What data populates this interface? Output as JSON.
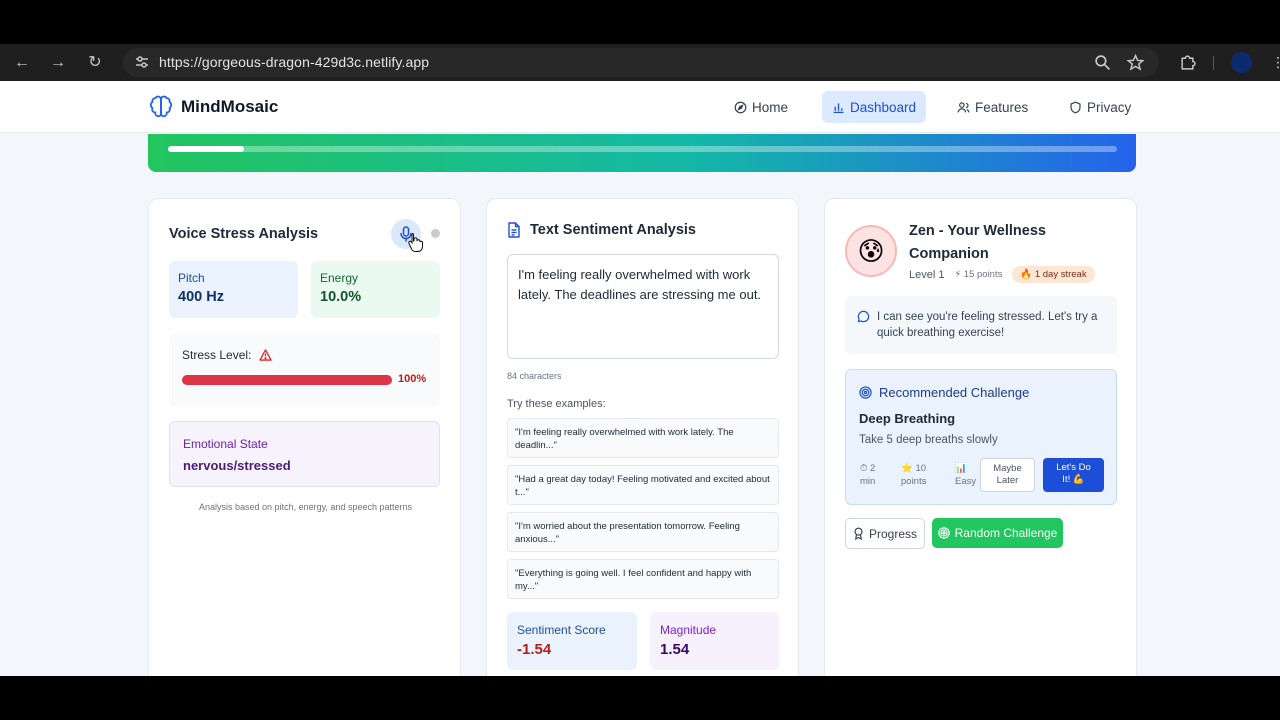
{
  "browser": {
    "url": "https://gorgeous-dragon-429d3c.netlify.app"
  },
  "nav": {
    "brand": "MindMosaic",
    "items": [
      {
        "label": "Home",
        "icon": "compass-icon"
      },
      {
        "label": "Dashboard",
        "icon": "bar-chart-icon",
        "active": true
      },
      {
        "label": "Features",
        "icon": "users-icon"
      },
      {
        "label": "Privacy",
        "icon": "shield-icon"
      }
    ]
  },
  "banner": {
    "progress_percent": 8
  },
  "voice": {
    "title": "Voice Stress Analysis",
    "pitch_label": "Pitch",
    "pitch_value": "400 Hz",
    "energy_label": "Energy",
    "energy_value": "10.0%",
    "stress_label": "Stress Level:",
    "stress_percent_text": "100%",
    "stress_percent": 100,
    "emotional_label": "Emotional State",
    "emotional_value": "nervous/stressed",
    "note": "Analysis based on pitch, energy, and speech patterns"
  },
  "text": {
    "title": "Text Sentiment Analysis",
    "input_value": "I'm feeling really overwhelmed with work lately. The deadlines are stressing me out.",
    "char_count": "84 characters",
    "examples_label": "Try these examples:",
    "examples": [
      "\"I'm feeling really overwhelmed with work lately. The deadlin...\"",
      "\"Had a great day today! Feeling motivated and excited about t...\"",
      "\"I'm worried about the presentation tomorrow. Feeling anxious...\"",
      "\"Everything is going well. I feel confident and happy with my...\""
    ],
    "sentiment_label": "Sentiment Score",
    "sentiment_value": "-1.54",
    "magnitude_label": "Magnitude",
    "magnitude_value": "1.54"
  },
  "companion": {
    "avatar": "😰",
    "title": "Zen - Your Wellness Companion",
    "level": "Level 1",
    "points": "⚡ 15 points",
    "streak": "🔥 1 day streak",
    "message": "I can see you're feeling stressed. Let's try a quick breathing exercise!",
    "challenge_header": "Recommended Challenge",
    "challenge_name": "Deep Breathing",
    "challenge_desc": "Take 5 deep breaths slowly",
    "meta_time_1": "⏱ 2",
    "meta_time_2": "min",
    "meta_points_1": "⭐ 10",
    "meta_points_2": "points",
    "meta_diff_1": "📊",
    "meta_diff_2": "Easy",
    "maybe_later_1": "Maybe",
    "maybe_later_2": "Later",
    "do_it_1": "Let's Do",
    "do_it_2": "It! 💪",
    "progress_button": "Progress",
    "random_button": "Random Challenge"
  },
  "colors": {
    "accent_blue": "#1d4ed8",
    "stress_red": "#dc3545",
    "success_green": "#22c55e"
  }
}
